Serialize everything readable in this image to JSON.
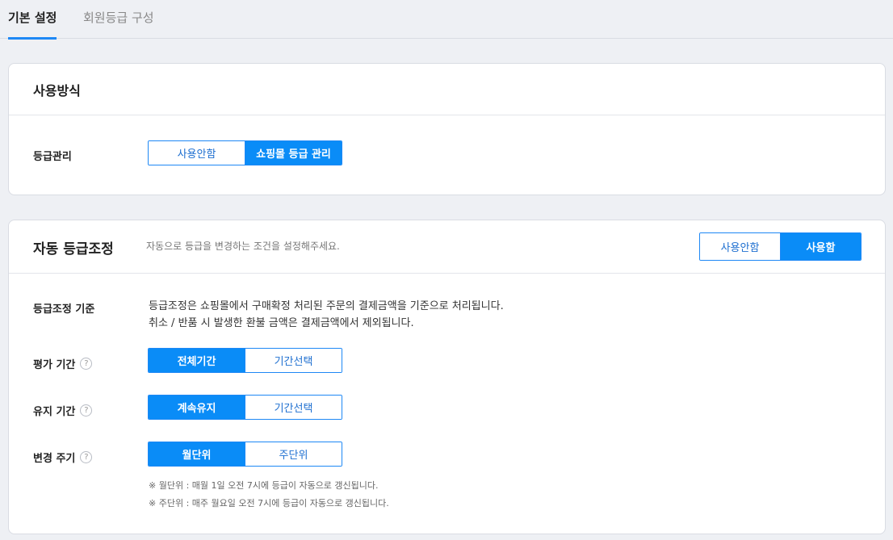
{
  "tabs": [
    {
      "label": "기본 설정",
      "active": true
    },
    {
      "label": "회원등급 구성",
      "active": false
    }
  ],
  "usage": {
    "title": "사용방식",
    "grade_manage": {
      "label": "등급관리",
      "options": [
        "사용안함",
        "쇼핑몰 등급 관리"
      ],
      "selected": "쇼핑몰 등급 관리"
    }
  },
  "auto": {
    "title": "자동 등급조정",
    "desc": "자동으로 등급을 변경하는 조건을 설정해주세요.",
    "toggle": {
      "options": [
        "사용안함",
        "사용함"
      ],
      "selected": "사용함"
    },
    "criteria": {
      "label": "등급조정 기준",
      "line1": "등급조정은 쇼핑몰에서 구매확정 처리된 주문의 결제금액을 기준으로 처리됩니다.",
      "line2": "취소 / 반품 시 발생한 환불 금액은 결제금액에서 제외됩니다."
    },
    "period": {
      "label": "평가 기간",
      "help": "?",
      "options": [
        "전체기간",
        "기간선택"
      ],
      "selected": "전체기간"
    },
    "keep": {
      "label": "유지 기간",
      "help": "?",
      "options": [
        "계속유지",
        "기간선택"
      ],
      "selected": "계속유지"
    },
    "cycle": {
      "label": "변경 주기",
      "help": "?",
      "options": [
        "월단위",
        "주단위"
      ],
      "selected": "월단위"
    },
    "notes": [
      "※ 월단위 : 매월 1일 오전 7시에 등급이 자동으로 갱신됩니다.",
      "※ 주단위 : 매주 월요일 오전 7시에 등급이 자동으로 갱신됩니다."
    ]
  },
  "colors": {
    "accent": "#0a8cf7",
    "background": "#eef0f4"
  }
}
